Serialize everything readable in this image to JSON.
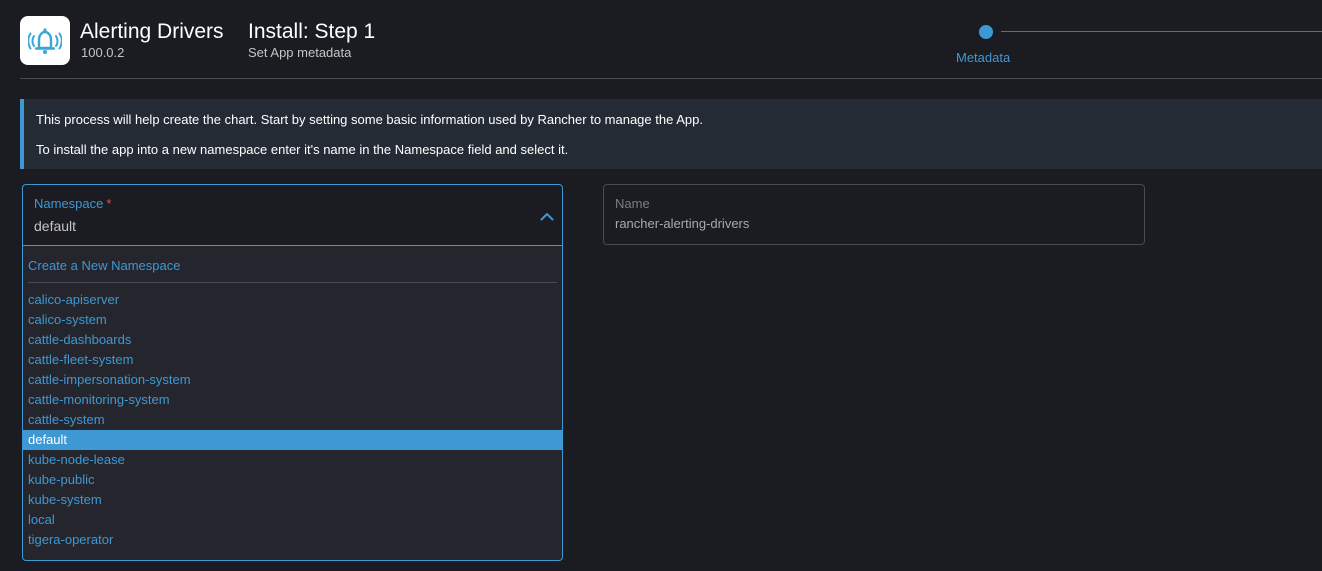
{
  "header": {
    "app_name": "Alerting Drivers",
    "app_version": "100.0.2",
    "step_title": "Install: Step 1",
    "step_subtitle": "Set App metadata",
    "logo_icon": "bell-alert-icon"
  },
  "stepper": {
    "steps": [
      {
        "label": "Metadata",
        "active": true
      }
    ]
  },
  "banner": {
    "line1": "This process will help create the chart. Start by setting some basic information used by Rancher to manage the App.",
    "line2": "To install the app into a new namespace enter it's name in the Namespace field and select it."
  },
  "namespace": {
    "label": "Namespace",
    "required_mark": "*",
    "value": "default",
    "create_label": "Create a New Namespace",
    "options": [
      "calico-apiserver",
      "calico-system",
      "cattle-dashboards",
      "cattle-fleet-system",
      "cattle-impersonation-system",
      "cattle-monitoring-system",
      "cattle-system",
      "default",
      "kube-node-lease",
      "kube-public",
      "kube-system",
      "local",
      "tigera-operator"
    ],
    "selected": "default"
  },
  "name_field": {
    "label": "Name",
    "value": "rancher-alerting-drivers"
  },
  "colors": {
    "accent": "#3d98d3",
    "background": "#1b1c21",
    "banner_bg": "#242b35",
    "required": "#e0534b"
  }
}
